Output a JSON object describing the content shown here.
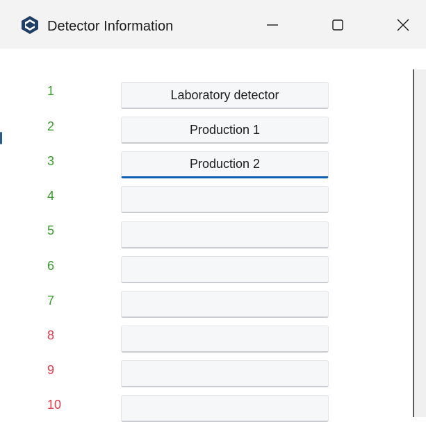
{
  "window": {
    "title": "Detector Information",
    "accent_color": "#0e5fb4"
  },
  "icons": {
    "app": "app-logo-icon",
    "minimize": "minimize-icon",
    "maximize": "maximize-icon",
    "close": "close-icon"
  },
  "detectors": [
    {
      "number": "1",
      "name": "Laboratory detector",
      "status": "green"
    },
    {
      "number": "2",
      "name": "Production 1",
      "status": "green"
    },
    {
      "number": "3",
      "name": "Production 2",
      "status": "green",
      "focused": true
    },
    {
      "number": "4",
      "name": "",
      "status": "green"
    },
    {
      "number": "5",
      "name": "",
      "status": "green"
    },
    {
      "number": "6",
      "name": "",
      "status": "green"
    },
    {
      "number": "7",
      "name": "",
      "status": "green"
    },
    {
      "number": "8",
      "name": "",
      "status": "red"
    },
    {
      "number": "9",
      "name": "",
      "status": "red"
    },
    {
      "number": "10",
      "name": "",
      "status": "red"
    }
  ],
  "status_colors": {
    "green": "#3a9a2e",
    "red": "#e23b4a"
  }
}
